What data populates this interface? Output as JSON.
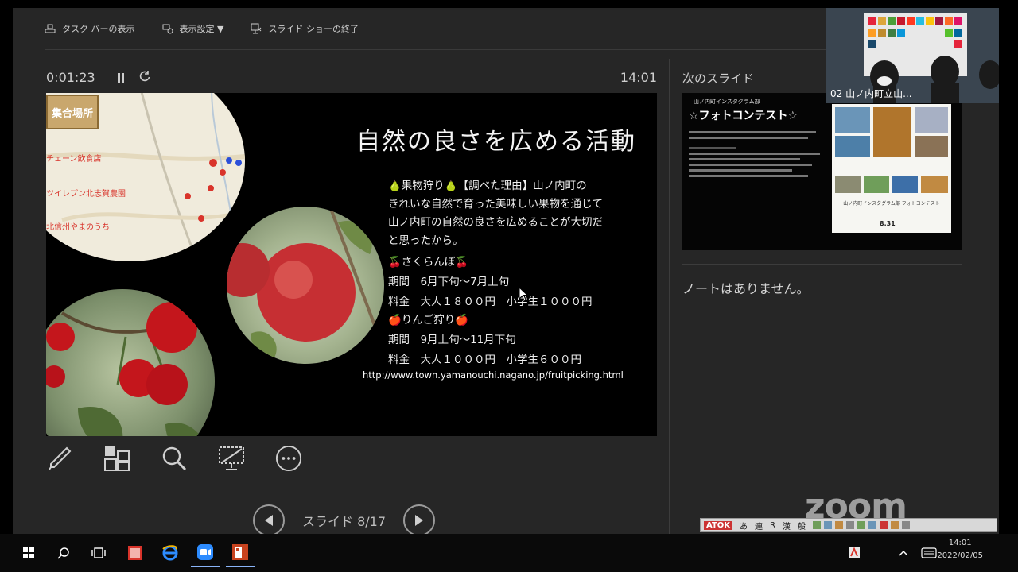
{
  "toolbar": {
    "taskbar_label": "タスク バーの表示",
    "display_label": "表示設定 ▼",
    "end_show_label": "スライド ショーの終了"
  },
  "presenter": {
    "elapsed": "0:01:23",
    "clock": "14:01",
    "next_slide_label": "次のスライド",
    "notes_text": "ノートはありません。",
    "slide_counter": "スライド 8/17"
  },
  "slide": {
    "title": "自然の良さを広める活動",
    "paragraph_1": "🍐果物狩り🍐【調べた理由】山ノ内町の",
    "paragraph_2": "きれいな自然で育った美味しい果物を通じて",
    "paragraph_3": "山ノ内町の自然の良さを広めることが大切だ",
    "paragraph_4": "と思ったから。",
    "cherry_heading": "🍒さくらんぼ🍒",
    "cherry_period": "期間　6月下旬〜7月上旬",
    "cherry_price": "料金　大人１８００円　小学生１０００円",
    "apple_heading": "🍎りんご狩り🍎",
    "apple_period": "期間　9月上旬〜11月下旬",
    "apple_price": "料金　大人１０００円　小学生６００円",
    "url": "http://www.town.yamanouchi.nagano.jp/fruitpicking.html",
    "map_label": "集合場所",
    "map_item_1": "チェーン飲食店",
    "map_item_2": "ツイレプン北志賀農園",
    "map_item_3": "北信州やまのうち"
  },
  "next_slide": {
    "header": "山ノ内町インスタグラム部",
    "title": "☆フォトコンテスト☆",
    "subtitle": "山ノ内町インスタグラム部 フォトコンテスト",
    "deadline": "8.31"
  },
  "video": {
    "participant": "02 山ノ内町立山..."
  },
  "watermark": "zoom",
  "ime": {
    "brand": "ATOK",
    "mode_1": "あ",
    "mode_2": "連",
    "mode_3": "R",
    "mode_4": "漢",
    "mode_5": "般"
  },
  "taskbar": {
    "time": "14:01",
    "date": "2022/02/05"
  },
  "colors": {
    "accent_red": "#d9342b",
    "office_orange": "#c8431f",
    "zoom_blue": "#2d8cff"
  }
}
